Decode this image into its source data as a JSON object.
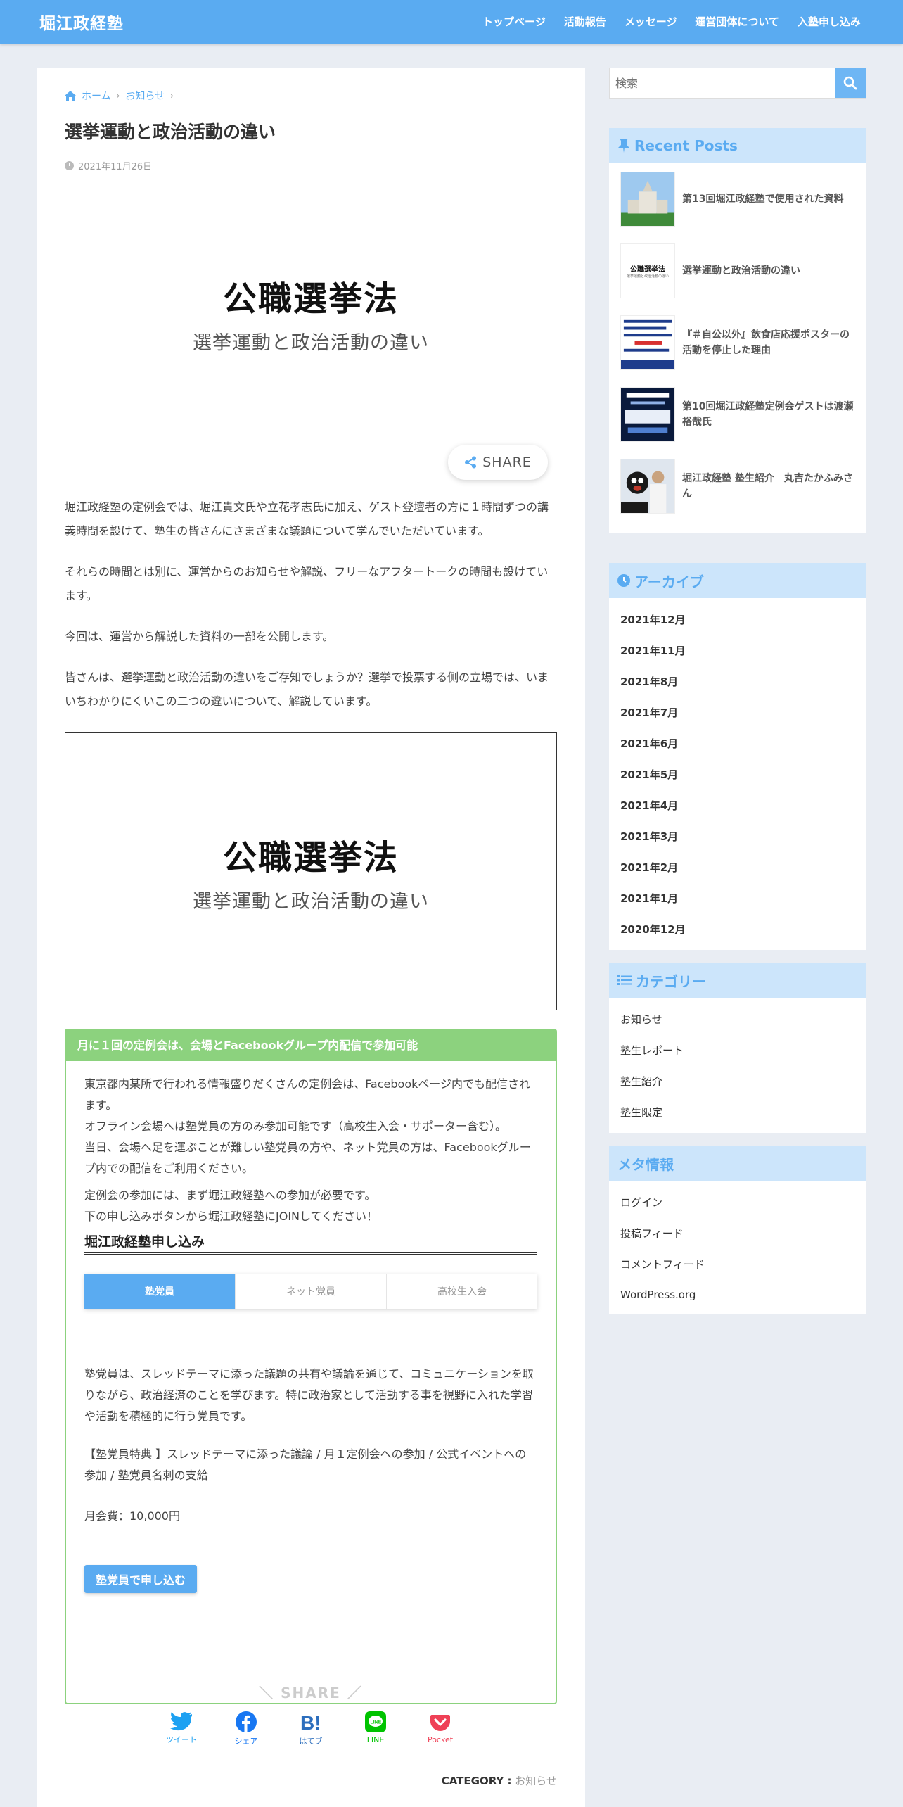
{
  "header": {
    "site_title": "堀江政経塾",
    "nav": [
      "トップページ",
      "活動報告",
      "メッセージ",
      "運営団体について",
      "入塾申し込み"
    ]
  },
  "breadcrumb": {
    "home": "ホーム",
    "category": "お知らせ"
  },
  "article": {
    "title": "選挙運動と政治活動の違い",
    "date": "2021年11月26日",
    "eyecatch": {
      "main": "公職選挙法",
      "sub": "選挙運動と政治活動の違い"
    },
    "share_pill": "SHARE",
    "paragraphs": [
      "堀江政経塾の定例会では、堀江貴文氏や立花孝志氏に加え、ゲスト登壇者の方に１時間ずつの講義時間を設けて、塾生の皆さんにさまざまな議題について学んでいただいています。",
      "それらの時間とは別に、運営からのお知らせや解説、フリーなアフタートークの時間も設けています。",
      "今回は、運営から解説した資料の一部を公開します。",
      "皆さんは、選挙運動と政治活動の違いをご存知でしょうか？選挙で投票する側の立場では、いまいちわかりにくいこの二つの違いについて、解説しています。"
    ],
    "image": {
      "main": "公職選挙法",
      "sub": "選挙運動と政治活動の違い"
    }
  },
  "green_box": {
    "heading": "月に１回の定例会は、会場とFacebookグループ内配信で参加可能",
    "text1": "東京都内某所で行われる情報盛りだくさんの定例会は、Facebookページ内でも配信されます。",
    "text2": "オフライン会場へは塾党員の方のみ参加可能です（高校生入会・サポーター含む）。",
    "text3": "当日、会場へ足を運ぶことが難しい塾党員の方や、ネット党員の方は、Facebookグループ内での配信をご利用ください。",
    "text4": "定例会の参加には、まず堀江政経塾への参加が必要です。",
    "text5": "下の申し込みボタンから堀江政経塾にJOINしてください！",
    "join_title": "堀江政経塾申し込み",
    "tabs": [
      "塾党員",
      "ネット党員",
      "高校生入会"
    ],
    "desc": "塾党員は、スレッドテーマに添った議題の共有や議論を通じて、コミュニケーションを取りながら、政治経済のことを学びます。特に政治家として活動する事を視野に入れた学習や活動を積極的に行う党員です。",
    "benefits": "【塾党員特典 】スレッドテーマに添った議論 / 月１定例会への参加 / 公式イベントへの参加 / 塾党員名刺の支給",
    "fee": "月会費：10,000円",
    "button": "塾党員で申し込む"
  },
  "share": {
    "title": "＼ SHARE ／",
    "buttons": [
      {
        "label": "ツイート",
        "color": "#1da1f2"
      },
      {
        "label": "シェア",
        "color": "#1877f2"
      },
      {
        "label": "はてブ",
        "color": "#2c6ebd"
      },
      {
        "label": "LINE",
        "color": "#00c300"
      },
      {
        "label": "Pocket",
        "color": "#ef4056"
      }
    ]
  },
  "category_line": {
    "label": "CATEGORY :",
    "value": "お知らせ"
  },
  "sidebar": {
    "search_placeholder": "検索",
    "recent_title": "Recent Posts",
    "recent_posts": [
      "第13回堀江政経塾で使用された資料",
      "選挙運動と政治活動の違い",
      "『＃自公以外』飲食店応援ポスターの活動を停止した理由",
      "第10回堀江政経塾定例会ゲストは渡瀬裕哉氏",
      "堀江政経塾 塾生紹介　丸吉たかふみさん"
    ],
    "thumb_text": {
      "title": "公職選挙法",
      "sub": "選挙運動と政治活動の違い"
    },
    "archive_title": "アーカイブ",
    "archives": [
      "2021年12月",
      "2021年11月",
      "2021年8月",
      "2021年7月",
      "2021年6月",
      "2021年5月",
      "2021年4月",
      "2021年3月",
      "2021年2月",
      "2021年1月",
      "2020年12月"
    ],
    "category_title": "カテゴリー",
    "categories": [
      "お知らせ",
      "塾生レポート",
      "塾生紹介",
      "塾生限定"
    ],
    "meta_title": "メタ情報",
    "meta": [
      "ログイン",
      "投稿フィード",
      "コメントフィード",
      "WordPress.org"
    ]
  },
  "colors": {
    "accent": "#5aabf1",
    "green": "#8cd27e",
    "widget_head": "#cce5fb"
  }
}
